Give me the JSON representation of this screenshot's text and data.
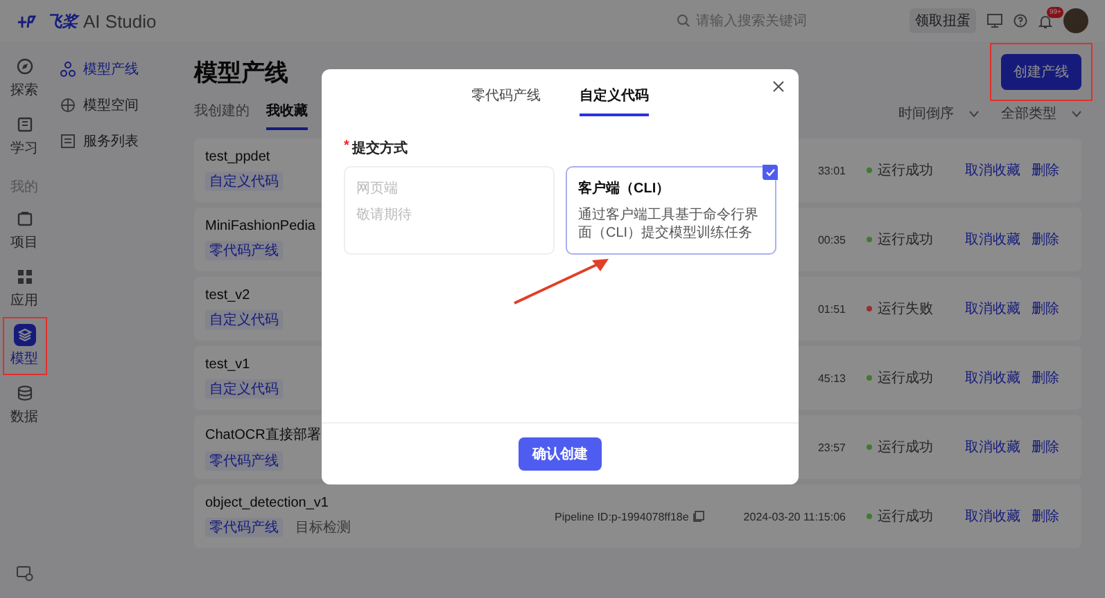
{
  "header": {
    "logo": {
      "brand": "飞桨",
      "product": "AI Studio"
    },
    "search": {
      "placeholder": "请输入搜索关键词"
    },
    "promo_button": "领取扭蛋",
    "notification_badge": "99+"
  },
  "rail": [
    {
      "kind": "item",
      "label": "探索",
      "selected": false,
      "highlighted": false
    },
    {
      "kind": "item",
      "label": "学习",
      "selected": false,
      "highlighted": false
    },
    {
      "kind": "section",
      "label": "我的"
    },
    {
      "kind": "item",
      "label": "项目",
      "selected": false,
      "highlighted": false
    },
    {
      "kind": "item",
      "label": "应用",
      "selected": false,
      "highlighted": false
    },
    {
      "kind": "item",
      "label": "模型",
      "selected": true,
      "highlighted": true
    },
    {
      "kind": "item",
      "label": "数据",
      "selected": false,
      "highlighted": false
    }
  ],
  "subnav": [
    {
      "label": "模型产线",
      "selected": true
    },
    {
      "label": "模型空间",
      "selected": false
    },
    {
      "label": "服务列表",
      "selected": false
    }
  ],
  "main": {
    "title": "模型产线",
    "create_button": {
      "label": "创建产线",
      "highlighted": true
    },
    "tabs": [
      {
        "label": "我创建的",
        "selected": false
      },
      {
        "label": "我收藏",
        "selected": true
      }
    ],
    "filters": [
      "时间倒序",
      "全部类型"
    ],
    "rows": [
      {
        "name": "test_ppdet",
        "tags": [
          "自定义代码"
        ],
        "time": "33:01",
        "status": {
          "text": "运行成功",
          "color": "#3f7a2e"
        },
        "actions": [
          "取消收藏",
          "删除"
        ]
      },
      {
        "name": "MiniFashionPedia",
        "tags": [
          "零代码产线"
        ],
        "time": "00:35",
        "status": {
          "text": "运行成功",
          "color": "#3f7a2e"
        },
        "actions": [
          "取消收藏",
          "删除"
        ]
      },
      {
        "name": "test_v2",
        "tags": [
          "自定义代码"
        ],
        "time": "01:51",
        "status": {
          "text": "运行失败",
          "color": "#9a2e2e"
        },
        "actions": [
          "取消收藏",
          "删除"
        ]
      },
      {
        "name": "test_v1",
        "tags": [
          "自定义代码"
        ],
        "time": "45:13",
        "status": {
          "text": "运行成功",
          "color": "#3f7a2e"
        },
        "actions": [
          "取消收藏",
          "删除"
        ]
      },
      {
        "name": "ChatOCR直接部署",
        "tags": [
          "零代码产线"
        ],
        "time": "23:57",
        "status": {
          "text": "运行成功",
          "color": "#3f7a2e"
        },
        "actions": [
          "取消收藏",
          "删除"
        ]
      },
      {
        "name": "object_detection_v1",
        "tags": [
          "零代码产线",
          "目标检测"
        ],
        "pipeline_id": "Pipeline ID:p-1994078ff18e",
        "time": "2024-03-20 11:15:06",
        "status": {
          "text": "运行成功",
          "color": "#3f7a2e"
        },
        "actions": [
          "取消收藏",
          "删除"
        ]
      }
    ]
  },
  "modal": {
    "tabs": [
      {
        "label": "零代码产线",
        "selected": false
      },
      {
        "label": "自定义代码",
        "selected": true
      }
    ],
    "required_mark": "*",
    "field_label": "提交方式",
    "options": [
      {
        "title": "网页端",
        "description": "敬请期待",
        "disabled": true,
        "selected": false,
        "pointed": false
      },
      {
        "title": "客户端（CLI）",
        "description": "通过客户端工具基于命令行界面（CLI）提交模型训练任务",
        "disabled": false,
        "selected": true,
        "pointed": true
      }
    ],
    "confirm_button": "确认创建"
  }
}
